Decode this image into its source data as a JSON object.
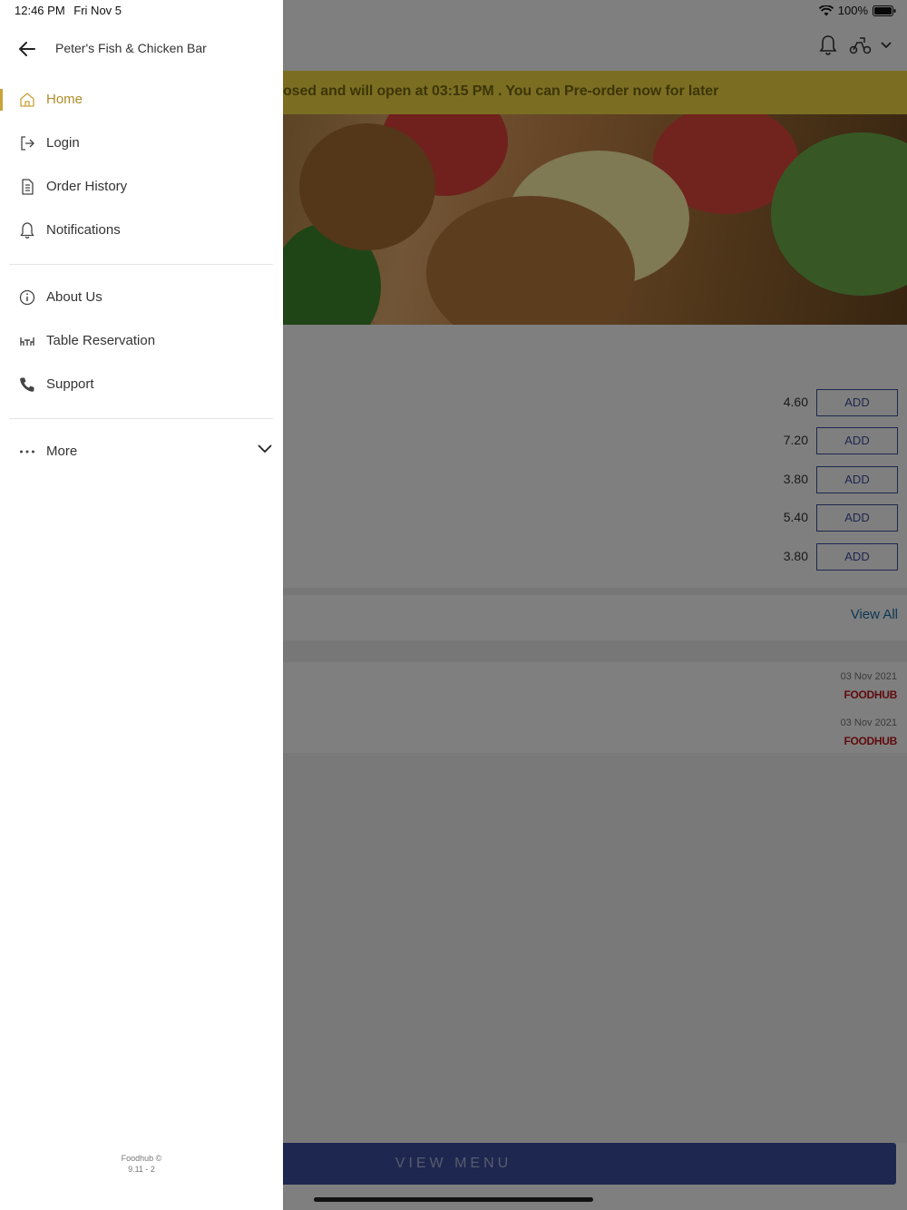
{
  "status_bar": {
    "time": "12:46 PM",
    "date": "Fri Nov 5",
    "battery": "100%"
  },
  "drawer": {
    "restaurant_name": "Peter's Fish & Chicken Bar",
    "primary_items": [
      {
        "label": "Home",
        "icon": "home-icon"
      },
      {
        "label": "Login",
        "icon": "login-icon"
      },
      {
        "label": "Order History",
        "icon": "document-icon"
      },
      {
        "label": "Notifications",
        "icon": "bell-icon"
      }
    ],
    "secondary_items": [
      {
        "label": "About Us",
        "icon": "info-icon"
      },
      {
        "label": "Table Reservation",
        "icon": "table-icon"
      },
      {
        "label": "Support",
        "icon": "phone-icon"
      }
    ],
    "more": {
      "label": "More",
      "icon": "more-dots-icon"
    },
    "footer": {
      "line1": "Foodhub ©",
      "line2": "9.11 - 2"
    }
  },
  "background": {
    "banner": "osed and will open at 03:15 PM . You can Pre-order now for later",
    "items": [
      {
        "price": "4.60",
        "action": "ADD"
      },
      {
        "price": "7.20",
        "action": "ADD"
      },
      {
        "price": "3.80",
        "action": "ADD"
      },
      {
        "price": "5.40",
        "action": "ADD"
      },
      {
        "price": "3.80",
        "action": "ADD"
      }
    ],
    "view_all": "View All",
    "reviews": [
      {
        "date": "03 Nov 2021",
        "brand": "FOODHUB"
      },
      {
        "date": "03 Nov 2021",
        "brand": "FOODHUB"
      }
    ],
    "view_menu": "VIEW MENU"
  },
  "colors": {
    "accent": "#c9a23a",
    "primary": "#3c4fa0",
    "banner": "#f7dc45",
    "brand_red": "#c0161c"
  }
}
